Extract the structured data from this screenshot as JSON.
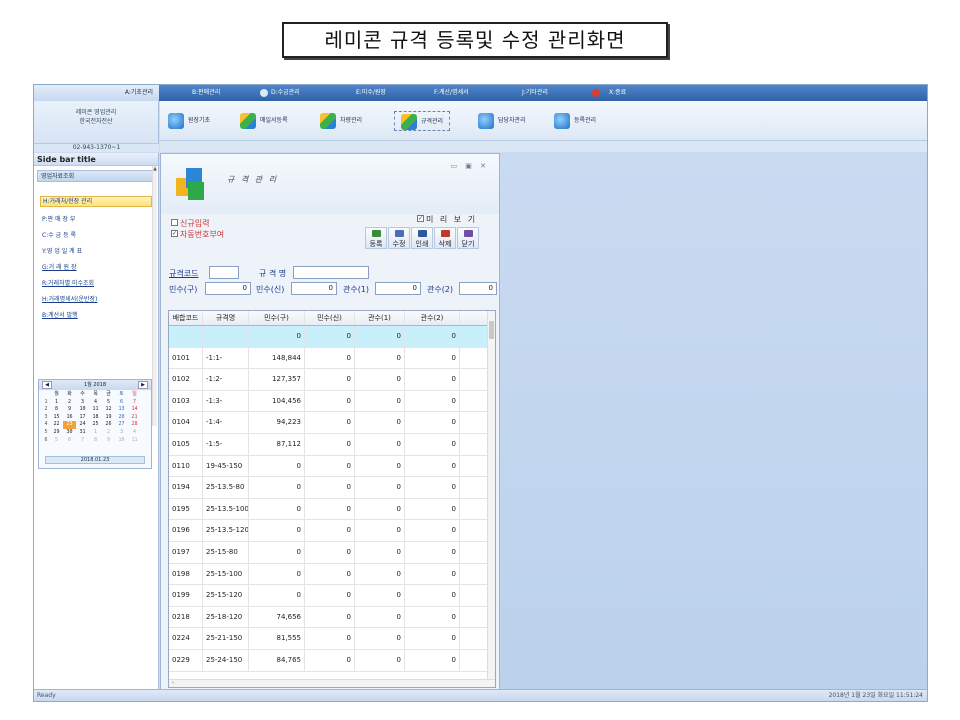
{
  "caption": "레미콘 규격 등록및 수정 관리화면",
  "menu": [
    {
      "label": "A:기초관리"
    },
    {
      "label": "B:판매관리"
    },
    {
      "label": "D:수금관리"
    },
    {
      "label": "E:미수/원장"
    },
    {
      "label": "F:계산/명세서"
    },
    {
      "label": "J:기타관리"
    },
    {
      "label": "X:종료"
    }
  ],
  "company": {
    "line1": "레미콘 영업관리",
    "line2": "한국전자전산",
    "phone": "02-943-1370~1"
  },
  "toolbar": [
    {
      "label": "원장기초",
      "icon": "arrow-icon"
    },
    {
      "label": "매일서등록",
      "icon": "cube-icon"
    },
    {
      "label": "차량관리",
      "icon": "cube-icon"
    },
    {
      "label": "규격관리",
      "icon": "cube-icon"
    },
    {
      "label": "담당자관리",
      "icon": "arrow-icon"
    },
    {
      "label": "등록관리",
      "icon": "arrow-icon"
    }
  ],
  "sidebar": {
    "title": "Side bar title",
    "group": "영업자료조회",
    "items": [
      {
        "label": "H:거래처/현장 관리"
      },
      {
        "label": "P:판 매 장 부"
      },
      {
        "label": "C:수 금 등 록"
      },
      {
        "label": "Y:영 업 일 계 표"
      },
      {
        "label": "G:거 래 원 장"
      },
      {
        "label": "R:거래처별 미수조회"
      },
      {
        "label": "H:거래명세서(운반장)"
      },
      {
        "label": "B:계산서 발행"
      }
    ]
  },
  "calendar": {
    "month_label": "1월 2018",
    "weekdays": [
      "월",
      "화",
      "수",
      "목",
      "금",
      "토",
      "일"
    ],
    "weeks": [
      {
        "wk": "1",
        "days": [
          "1",
          "2",
          "3",
          "4",
          "5",
          "6",
          "7"
        ]
      },
      {
        "wk": "2",
        "days": [
          "8",
          "9",
          "10",
          "11",
          "12",
          "13",
          "14"
        ]
      },
      {
        "wk": "3",
        "days": [
          "15",
          "16",
          "17",
          "18",
          "19",
          "20",
          "21"
        ]
      },
      {
        "wk": "4",
        "days": [
          "22",
          "23",
          "24",
          "25",
          "26",
          "27",
          "28"
        ]
      },
      {
        "wk": "5",
        "days": [
          "29",
          "30",
          "31",
          "1",
          "2",
          "3",
          "4"
        ]
      },
      {
        "wk": "6",
        "days": [
          "5",
          "6",
          "7",
          "8",
          "9",
          "10",
          "11"
        ]
      }
    ],
    "today": "23",
    "footer": "2018.01.23"
  },
  "window": {
    "title": "규 격 관 리",
    "new_input": "신규입력",
    "auto_number": "자동번호부여",
    "preview": "미 리 보 기",
    "buttons": [
      {
        "label": "등록",
        "color": "#3c8a3c"
      },
      {
        "label": "수정",
        "color": "#4a6fb5"
      },
      {
        "label": "인쇄",
        "color": "#2d5a9e"
      },
      {
        "label": "삭제",
        "color": "#c0392b"
      },
      {
        "label": "닫기",
        "color": "#6a4fa5"
      }
    ],
    "fields": {
      "code_label": "규격코드",
      "code_value": "",
      "name_label": "규 격 명",
      "name_value": "",
      "price1_label": "민수(구)",
      "price1_value": "0",
      "price2_label": "민수(신)",
      "price2_value": "0",
      "gov1_label": "관수(1)",
      "gov1_value": "0",
      "gov2_label": "관수(2)",
      "gov2_value": "0"
    },
    "grid": {
      "headers": [
        "배합코드",
        "규격명",
        "민수(구)",
        "민수(신)",
        "관수(1)",
        "관수(2)"
      ],
      "rows": [
        [
          "",
          "",
          "0",
          "0",
          "0",
          "0"
        ],
        [
          "0101",
          "-1:1-",
          "148,844",
          "0",
          "0",
          "0"
        ],
        [
          "0102",
          "-1:2-",
          "127,357",
          "0",
          "0",
          "0"
        ],
        [
          "0103",
          "-1:3-",
          "104,456",
          "0",
          "0",
          "0"
        ],
        [
          "0104",
          "-1:4-",
          "94,223",
          "0",
          "0",
          "0"
        ],
        [
          "0105",
          "-1:5-",
          "87,112",
          "0",
          "0",
          "0"
        ],
        [
          "0110",
          "19-45-150",
          "0",
          "0",
          "0",
          "0"
        ],
        [
          "0194",
          "25-13.5-80",
          "0",
          "0",
          "0",
          "0"
        ],
        [
          "0195",
          "25-13.5-100",
          "0",
          "0",
          "0",
          "0"
        ],
        [
          "0196",
          "25-13.5-120",
          "0",
          "0",
          "0",
          "0"
        ],
        [
          "0197",
          "25-15-80",
          "0",
          "0",
          "0",
          "0"
        ],
        [
          "0198",
          "25-15-100",
          "0",
          "0",
          "0",
          "0"
        ],
        [
          "0199",
          "25-15-120",
          "0",
          "0",
          "0",
          "0"
        ],
        [
          "0218",
          "25-18-120",
          "74,656",
          "0",
          "0",
          "0"
        ],
        [
          "0224",
          "25-21-150",
          "81,555",
          "0",
          "0",
          "0"
        ],
        [
          "0229",
          "25-24-150",
          "84,765",
          "0",
          "0",
          "0"
        ]
      ]
    }
  },
  "status": {
    "left": "Ready",
    "right": "2018년 1월 23일 화요일 11:51:24"
  }
}
